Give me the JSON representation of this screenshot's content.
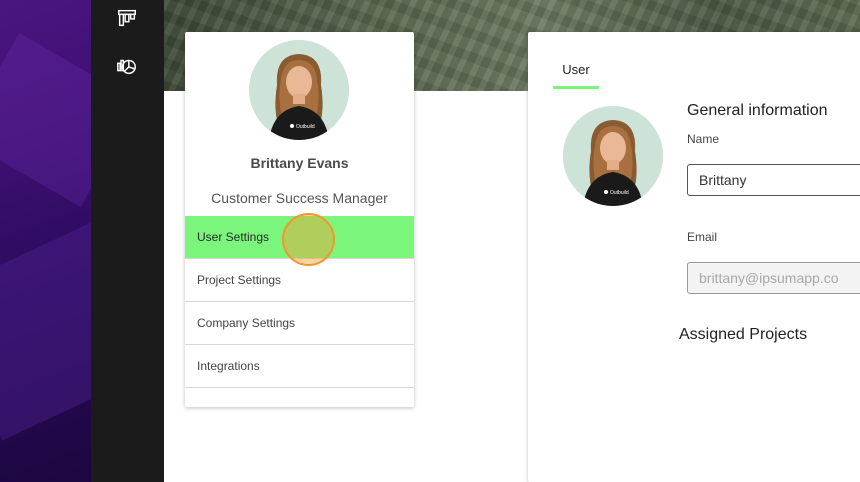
{
  "app": {
    "nav_icons": [
      "board-icon",
      "analytics-icon"
    ]
  },
  "profile": {
    "name": "Brittany Evans",
    "role": "Customer Success Manager",
    "shirt_logo": "Outbuild"
  },
  "settings_menu": {
    "items": [
      {
        "label": "User Settings",
        "active": true
      },
      {
        "label": "Project Settings",
        "active": false
      },
      {
        "label": "Company Settings",
        "active": false
      },
      {
        "label": "Integrations",
        "active": false
      }
    ]
  },
  "detail": {
    "tab_label": "User",
    "section_title": "General information",
    "name_label": "Name",
    "name_value": "Brittany",
    "email_label": "Email",
    "email_value": "brittany@ipsumapp.co",
    "assigned_title": "Assigned Projects"
  },
  "colors": {
    "accent_green": "#7cf57c",
    "sidebar_dark": "#1b1b1b",
    "click_indicator": "#f2962e"
  }
}
